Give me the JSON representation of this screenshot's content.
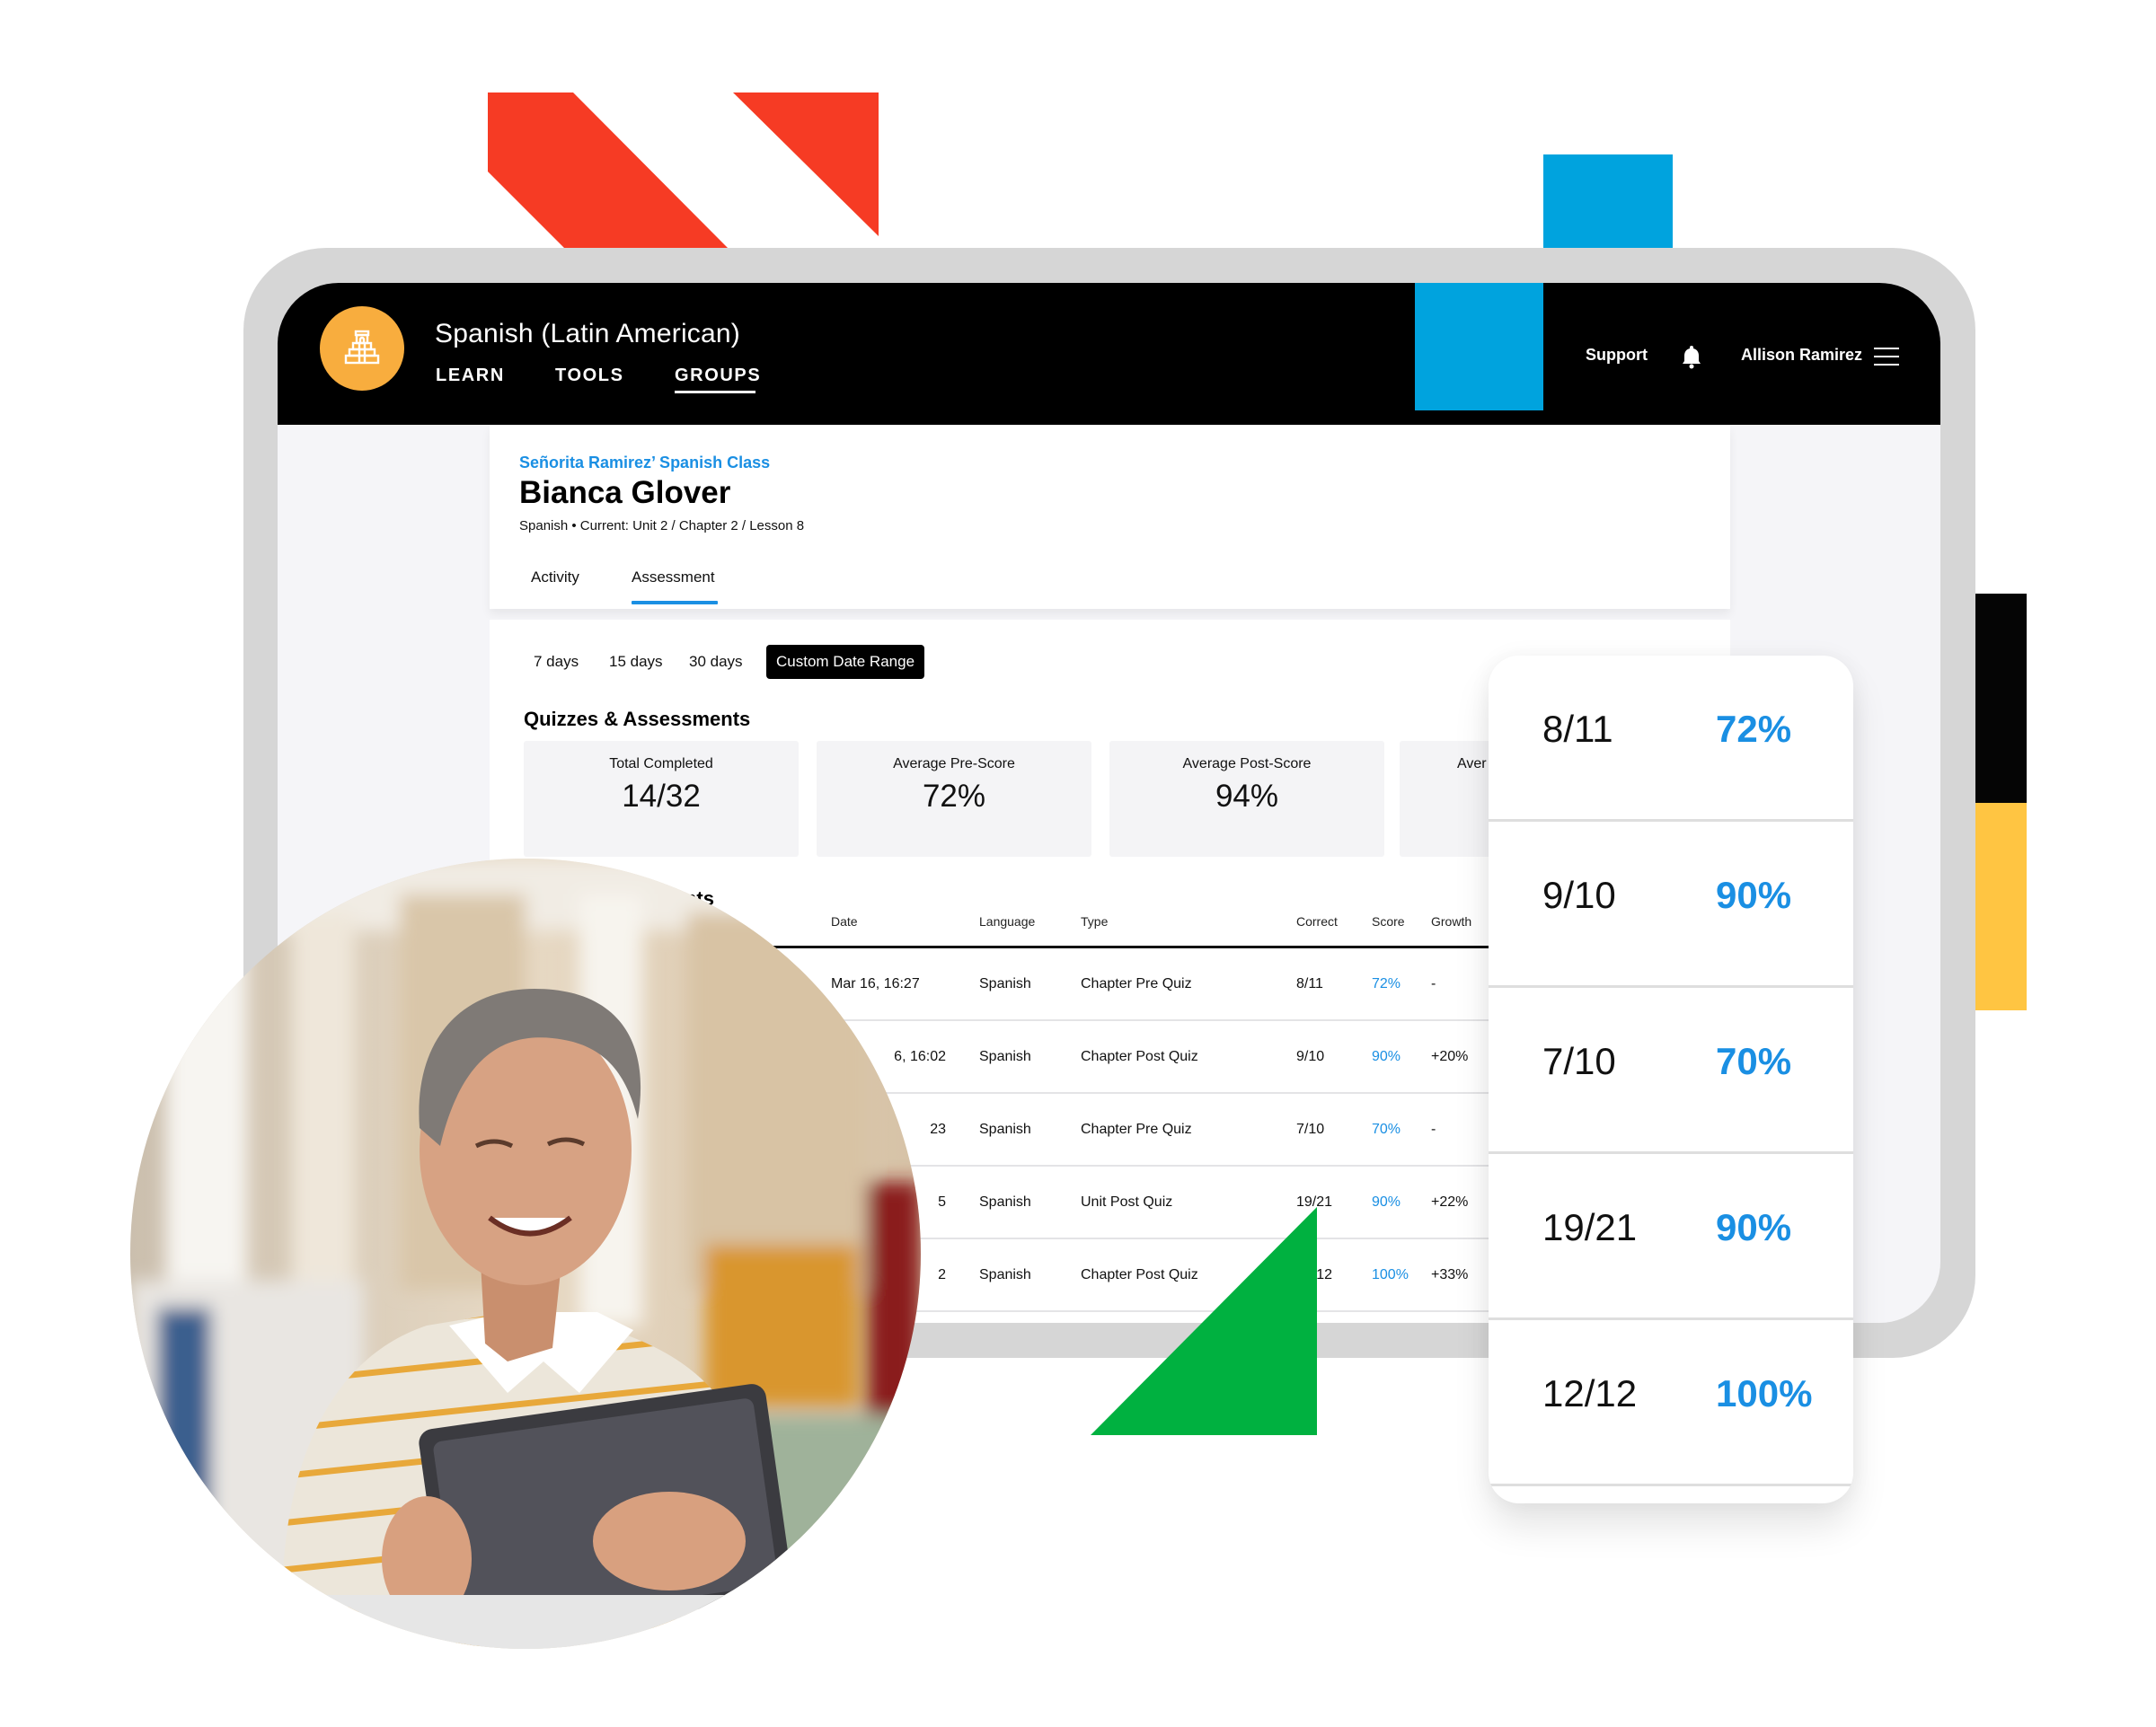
{
  "colors": {
    "accent_red": "#f63b24",
    "accent_blue": "#00a3de",
    "accent_green": "#00b140",
    "accent_yellow": "#ffc542",
    "logo_orange": "#f8ad3e",
    "link_blue": "#1a8fe3"
  },
  "header": {
    "logo_icon": "pyramid-temple-icon",
    "course_title": "Spanish (Latin American)",
    "nav": [
      {
        "label": "LEARN",
        "active": false
      },
      {
        "label": "TOOLS",
        "active": false
      },
      {
        "label": "GROUPS",
        "active": true
      }
    ],
    "support_label": "Support",
    "notification_icon": "bell-icon",
    "user_name": "Allison Ramirez",
    "menu_icon": "hamburger-icon"
  },
  "profile": {
    "breadcrumb": "Señorita Ramirez’ Spanish Class",
    "student_name": "Bianca Glover",
    "subtitle": "Spanish • Current: Unit 2 / Chapter 2 / Lesson 8",
    "tabs": [
      {
        "label": "Activity",
        "active": false
      },
      {
        "label": "Assessment",
        "active": true
      }
    ]
  },
  "filters": {
    "ranges": [
      "7 days",
      "15 days",
      "30 days",
      "Custom Date Range"
    ],
    "active": "Custom Date Range"
  },
  "quizzes": {
    "title": "Quizzes & Assessments",
    "stats": [
      {
        "label": "Total Completed",
        "value": "14/32"
      },
      {
        "label": "Average Pre-Score",
        "value": "72%"
      },
      {
        "label": "Average Post-Score",
        "value": "94%"
      },
      {
        "label": "Aver",
        "value": ""
      }
    ]
  },
  "assessments_table": {
    "title": "Assessments",
    "columns": [
      "Date",
      "Language",
      "Type",
      "Correct",
      "Score",
      "Growth"
    ],
    "rows": [
      {
        "date": "Mar 16, 16:27",
        "language": "Spanish",
        "type": "Chapter Pre Quiz",
        "correct": "8/11",
        "score": "72%",
        "growth": "-"
      },
      {
        "date": "6, 16:02",
        "language": "Spanish",
        "type": "Chapter Post Quiz",
        "correct": "9/10",
        "score": "90%",
        "growth": "+20%"
      },
      {
        "date": "23",
        "language": "Spanish",
        "type": "Chapter Pre Quiz",
        "correct": "7/10",
        "score": "70%",
        "growth": "-"
      },
      {
        "date": "5",
        "language": "Spanish",
        "type": "Unit Post Quiz",
        "correct": "19/21",
        "score": "90%",
        "growth": "+22%"
      },
      {
        "date": "2",
        "language": "Spanish",
        "type": "Chapter Post Quiz",
        "correct": "12/12",
        "score": "100%",
        "growth": "+33%"
      }
    ]
  },
  "score_card": {
    "rows": [
      {
        "correct": "8/11",
        "score": "72%"
      },
      {
        "correct": "9/10",
        "score": "90%"
      },
      {
        "correct": "7/10",
        "score": "70%"
      },
      {
        "correct": "19/21",
        "score": "90%"
      },
      {
        "correct": "12/12",
        "score": "100%"
      }
    ]
  },
  "photo": {
    "description": "Smiling man in striped sweater using a tablet"
  }
}
